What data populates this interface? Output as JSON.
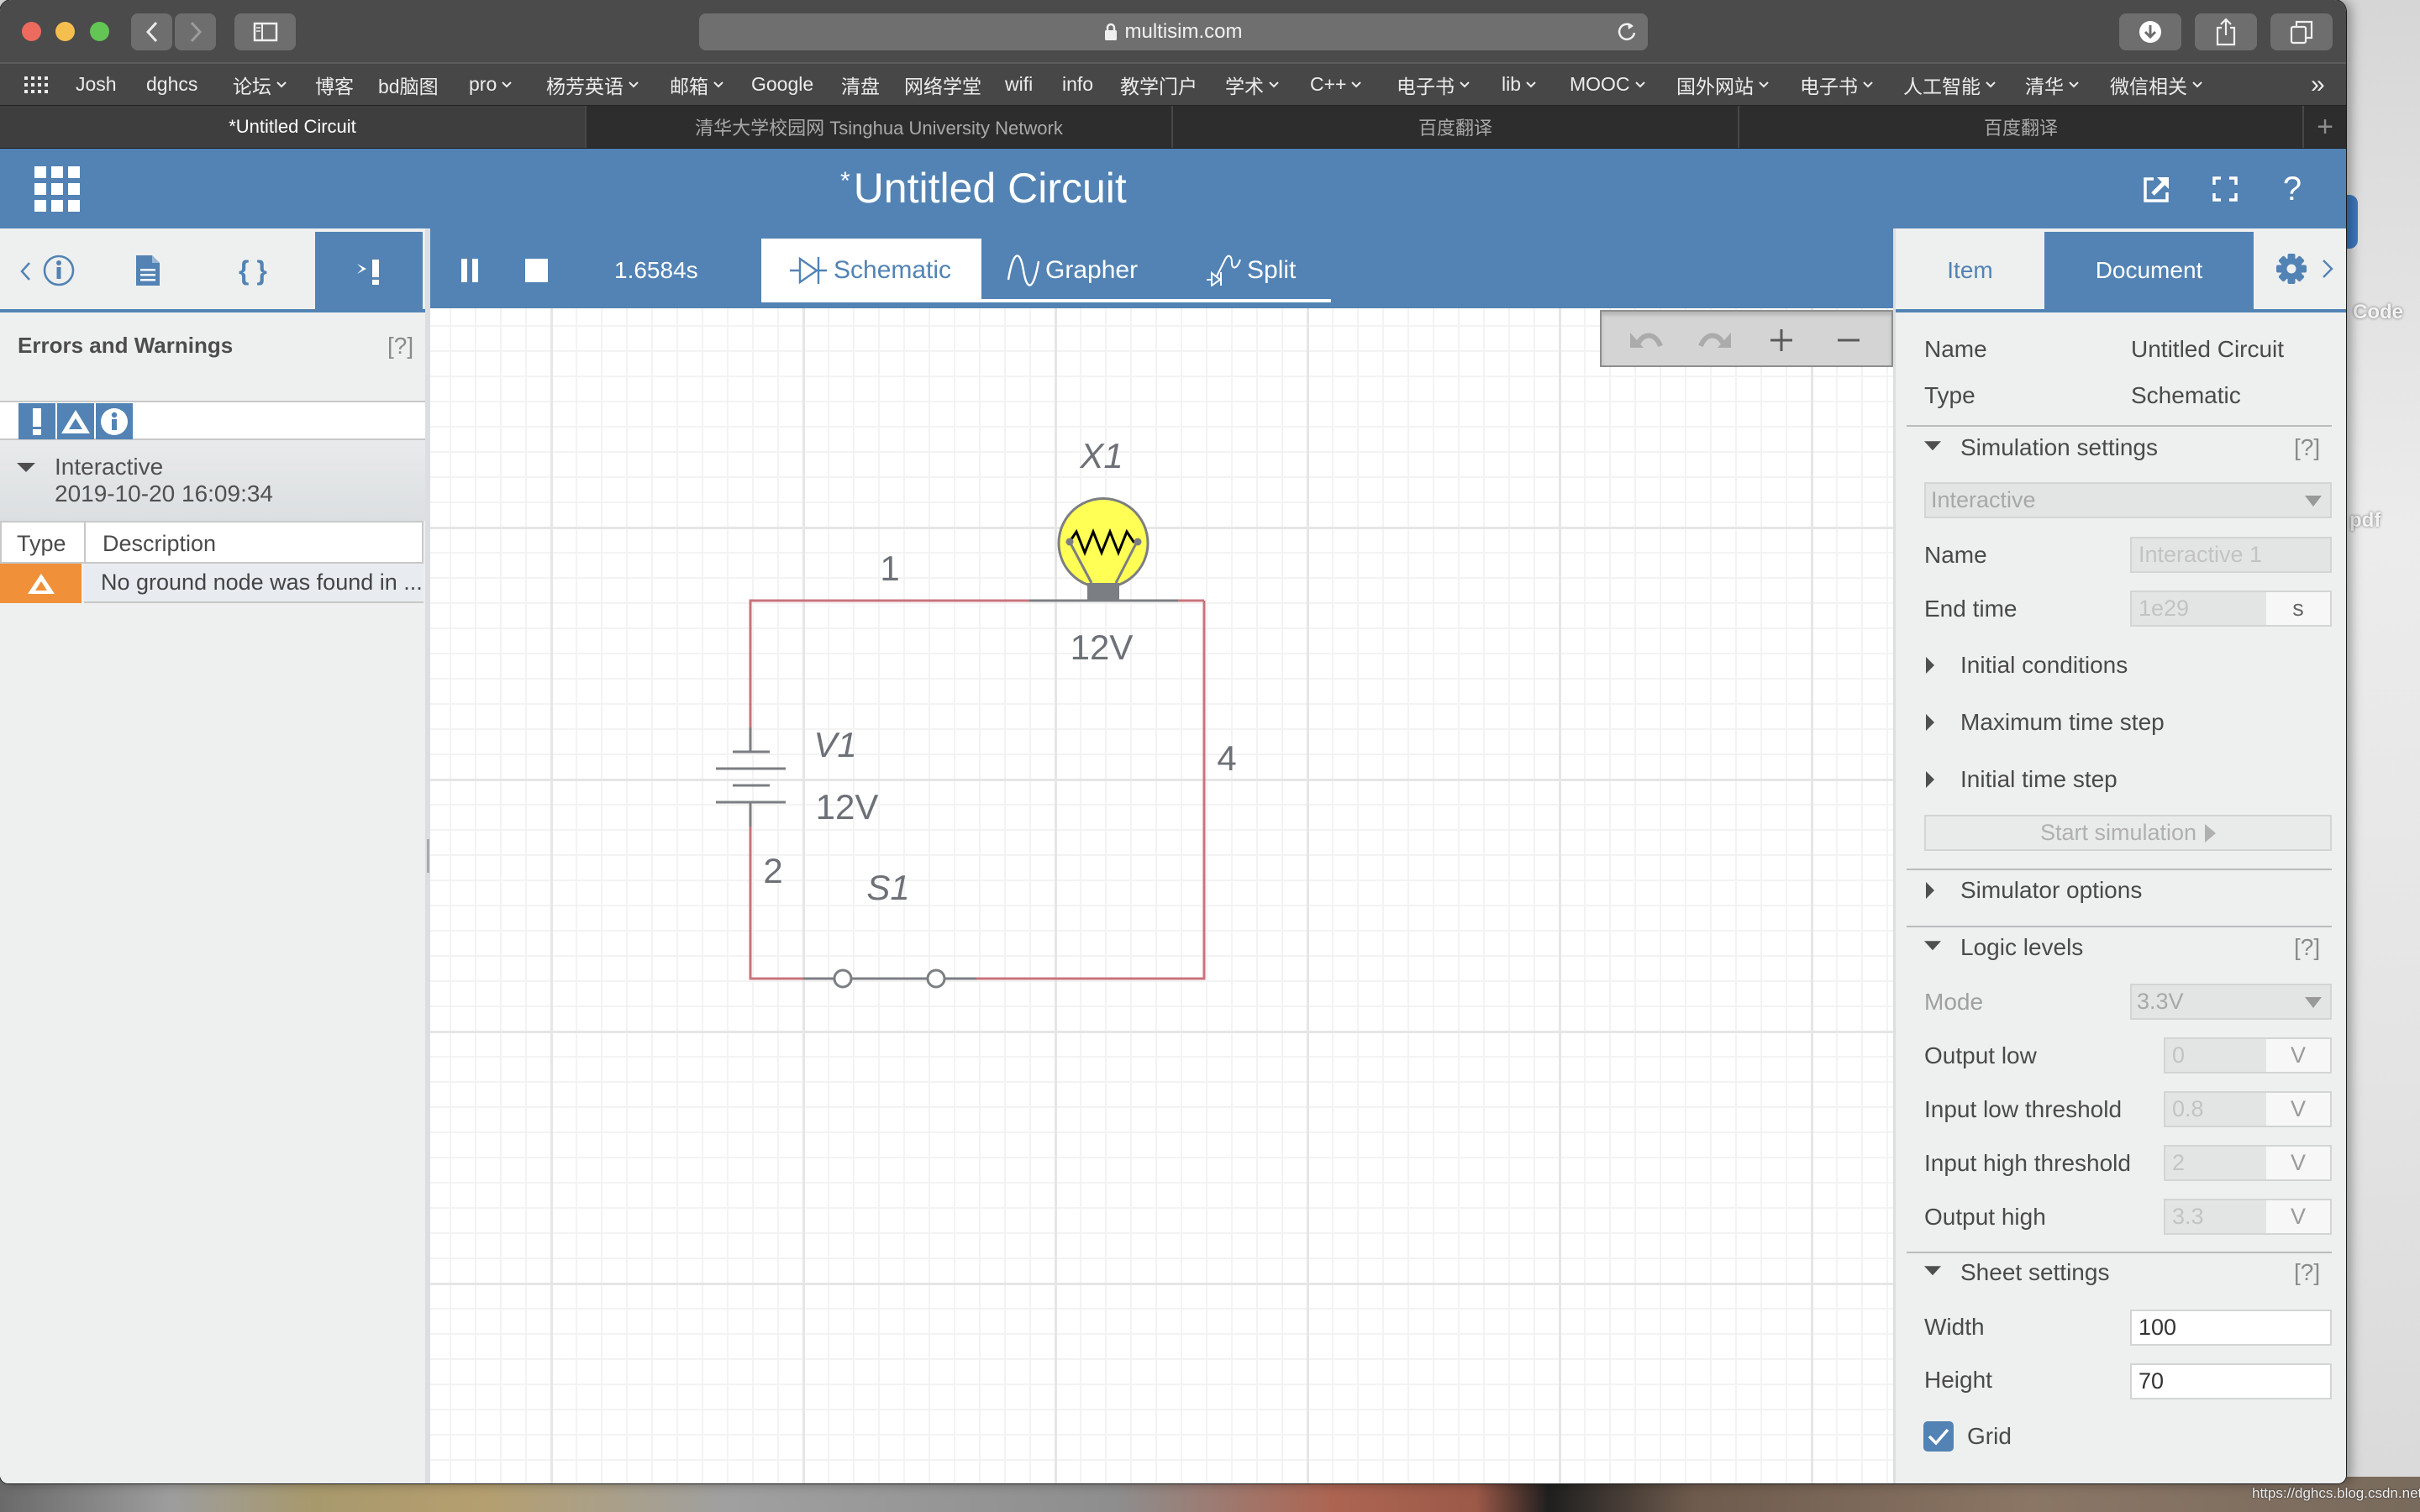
{
  "browser": {
    "url": "multisim.com",
    "bookmarks": [
      {
        "label": "Josh",
        "menu": false
      },
      {
        "label": "dghcs",
        "menu": false
      },
      {
        "label": "论坛",
        "menu": true
      },
      {
        "label": "博客",
        "menu": false
      },
      {
        "label": "bd脑图",
        "menu": false
      },
      {
        "label": "pro",
        "menu": true
      },
      {
        "label": "杨芳英语",
        "menu": true
      },
      {
        "label": "邮箱",
        "menu": true
      },
      {
        "label": "Google",
        "menu": false
      },
      {
        "label": "清盘",
        "menu": false
      },
      {
        "label": "网络学堂",
        "menu": false
      },
      {
        "label": "wifi",
        "menu": false
      },
      {
        "label": "info",
        "menu": false
      },
      {
        "label": "教学门户",
        "menu": false
      },
      {
        "label": "学术",
        "menu": true
      },
      {
        "label": "C++",
        "menu": true
      },
      {
        "label": "电子书",
        "menu": true
      },
      {
        "label": "lib",
        "menu": true
      },
      {
        "label": "MOOC",
        "menu": true
      },
      {
        "label": "国外网站",
        "menu": true
      },
      {
        "label": "电子书",
        "menu": true
      },
      {
        "label": "人工智能",
        "menu": true
      },
      {
        "label": "清华",
        "menu": true
      },
      {
        "label": "微信相关",
        "menu": true
      }
    ],
    "bookmarks_overflow": "»",
    "tabs": [
      {
        "title": "*Untitled Circuit",
        "active": true
      },
      {
        "title": "清华大学校园网 Tsinghua University Network",
        "active": false
      },
      {
        "title": "百度翻译",
        "active": false
      },
      {
        "title": "百度翻译",
        "active": false
      }
    ],
    "new_tab": "+"
  },
  "app": {
    "title_modified_marker": "*",
    "title": "Untitled Circuit",
    "help_glyph": "?",
    "accent_color": "#5283b4"
  },
  "left_panel": {
    "tabs": [
      {
        "icon": "info-icon",
        "active": false
      },
      {
        "icon": "document-icon",
        "active": false
      },
      {
        "icon": "code-braces-icon",
        "glyph": "{ }",
        "active": false
      },
      {
        "icon": "errors-icon",
        "active": true
      }
    ],
    "title": "Errors and Warnings",
    "help": "[?]",
    "filters": [
      "errors",
      "warnings",
      "info"
    ],
    "group": {
      "name": "Interactive",
      "timestamp": "2019-10-20 16:09:34"
    },
    "table": {
      "columns": [
        "Type",
        "Description"
      ],
      "rows": [
        {
          "type": "warning",
          "description": "No ground node was found in ..."
        }
      ]
    },
    "warning_color": "#f0913a"
  },
  "toolbar": {
    "sim_time": "1.6584s",
    "tabs": [
      {
        "label": "Schematic",
        "active": true
      },
      {
        "label": "Grapher",
        "active": false
      },
      {
        "label": "Split",
        "active": false
      }
    ],
    "zoom_controls": [
      "undo",
      "redo",
      "zoom-in",
      "zoom-out"
    ]
  },
  "circuit": {
    "lamp": {
      "ref": "X1",
      "value": "12V"
    },
    "source": {
      "ref": "V1",
      "value": "12V"
    },
    "switch": {
      "ref": "S1"
    },
    "nets": {
      "top": "1",
      "left": "2",
      "right": "4"
    },
    "wire_color": "#c8737b",
    "component_color": "#7b7e82",
    "lamp_color": "#ffff55"
  },
  "right_panel": {
    "tabs": [
      {
        "label": "Item",
        "active": false
      },
      {
        "label": "Document",
        "active": true
      }
    ],
    "document": {
      "name_label": "Name",
      "name": "Untitled Circuit",
      "type_label": "Type",
      "type": "Schematic"
    },
    "simulation": {
      "title": "Simulation settings",
      "help": "[?]",
      "mode": "Interactive",
      "name_label": "Name",
      "name_value": "Interactive 1",
      "end_time_label": "End time",
      "end_time": "1e29",
      "end_time_unit": "s",
      "sections": [
        "Initial conditions",
        "Maximum time step",
        "Initial time step"
      ],
      "start_button": "Start simulation"
    },
    "simulator_options": "Simulator options",
    "logic": {
      "title": "Logic levels",
      "help": "[?]",
      "mode_label": "Mode",
      "mode": "3.3V",
      "fields": [
        {
          "label": "Output low",
          "value": "0",
          "unit": "V"
        },
        {
          "label": "Input low threshold",
          "value": "0.8",
          "unit": "V"
        },
        {
          "label": "Input high threshold",
          "value": "2",
          "unit": "V"
        },
        {
          "label": "Output high",
          "value": "3.3",
          "unit": "V"
        }
      ]
    },
    "sheet": {
      "title": "Sheet settings",
      "help": "[?]",
      "width_label": "Width",
      "width": "100",
      "height_label": "Height",
      "height": "70",
      "grid_label": "Grid",
      "grid": true
    }
  },
  "desktop": {
    "icon_labels": [
      "Code",
      "pdf"
    ],
    "watermark": "https://dghcs.blog.csdn.net"
  }
}
